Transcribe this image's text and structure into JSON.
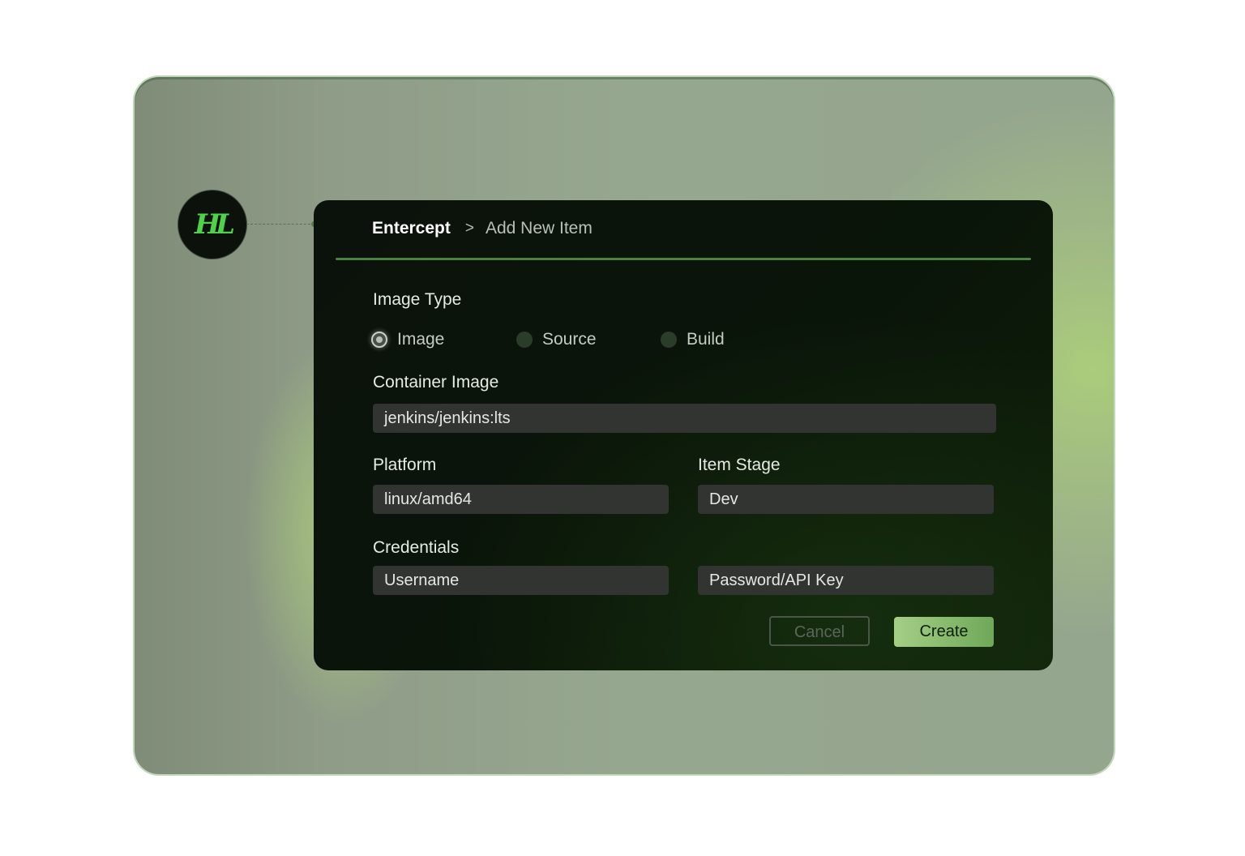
{
  "logo": {
    "icon": "gothic-monogram-logo-icon",
    "letters": "HL",
    "color": "#4fd14a"
  },
  "breadcrumb": {
    "root": "Entercept",
    "separator": ">",
    "current": "Add New Item"
  },
  "form": {
    "image_type": {
      "label": "Image Type",
      "options": [
        {
          "label": "Image",
          "selected": true
        },
        {
          "label": "Source",
          "selected": false
        },
        {
          "label": "Build",
          "selected": false
        }
      ]
    },
    "container_image": {
      "label": "Container Image",
      "value": "jenkins/jenkins:lts"
    },
    "platform": {
      "label": "Platform",
      "value": "linux/amd64"
    },
    "item_stage": {
      "label": "Item Stage",
      "value": "Dev"
    },
    "credentials": {
      "label": "Credentials",
      "username_placeholder": "Username",
      "password_placeholder": "Password/API Key"
    }
  },
  "actions": {
    "cancel": "Cancel",
    "create": "Create"
  },
  "colors": {
    "accent": "#4d8140",
    "create_button": "#8cc06f",
    "card_background": "#0b130a",
    "field_background": "#323432"
  }
}
